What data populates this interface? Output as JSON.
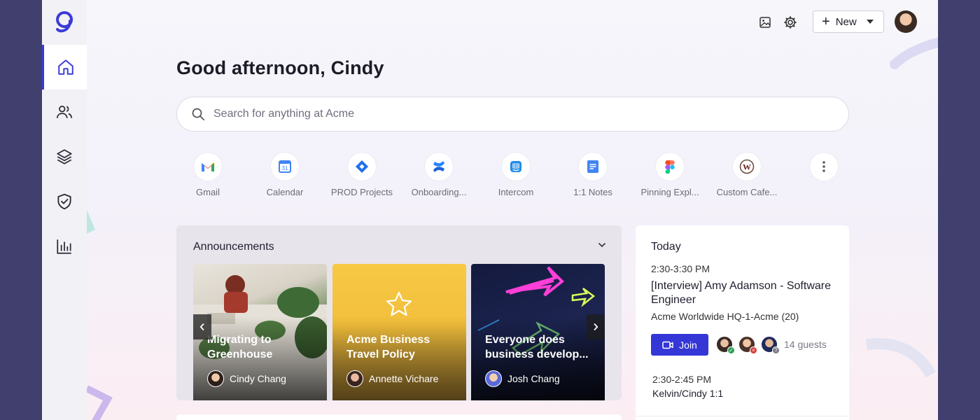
{
  "colors": {
    "accent": "#3436d6",
    "sidebar_active": "#3b3bd8",
    "background_outer": "#403f6e"
  },
  "sidebar": {
    "items": [
      {
        "name": "home",
        "icon": "home-icon",
        "active": true
      },
      {
        "name": "people",
        "icon": "people-icon",
        "active": false
      },
      {
        "name": "layers",
        "icon": "layers-icon",
        "active": false
      },
      {
        "name": "shield",
        "icon": "shield-check-icon",
        "active": false
      },
      {
        "name": "analytics",
        "icon": "bar-chart-icon",
        "active": false
      }
    ]
  },
  "topbar": {
    "new_label": "New"
  },
  "greeting": "Good afternoon, Cindy",
  "search": {
    "placeholder": "Search for anything at Acme",
    "value": ""
  },
  "apps": [
    {
      "label": "Gmail",
      "icon": "gmail-icon"
    },
    {
      "label": "Calendar",
      "icon": "google-calendar-icon"
    },
    {
      "label": "PROD Projects",
      "icon": "jira-icon"
    },
    {
      "label": "Onboarding...",
      "icon": "confluence-icon"
    },
    {
      "label": "Intercom",
      "icon": "intercom-icon"
    },
    {
      "label": "1:1 Notes",
      "icon": "google-docs-icon"
    },
    {
      "label": "Pinning Expl...",
      "icon": "figma-icon"
    },
    {
      "label": "Custom Cafe...",
      "icon": "w-logo-icon"
    },
    {
      "label": "",
      "icon": "more-vertical-icon"
    }
  ],
  "announcements": {
    "title": "Announcements",
    "cards": [
      {
        "title": "Migrating to Greenhouse",
        "author": "Cindy Chang"
      },
      {
        "title": "Acme Business Travel Policy",
        "author": "Annette Vichare"
      },
      {
        "title": "Everyone does business develop...",
        "author": "Josh Chang"
      }
    ]
  },
  "today": {
    "heading": "Today",
    "events": [
      {
        "time": "2:30-3:30 PM",
        "title": "[Interview] Amy Adamson - Software Engineer",
        "location": "Acme Worldwide HQ-1-Acme (20)",
        "join_label": "Join",
        "guests_label": "14 guests"
      },
      {
        "time": "2:30-2:45 PM",
        "title": "Kelvin/Cindy 1:1"
      }
    ]
  }
}
